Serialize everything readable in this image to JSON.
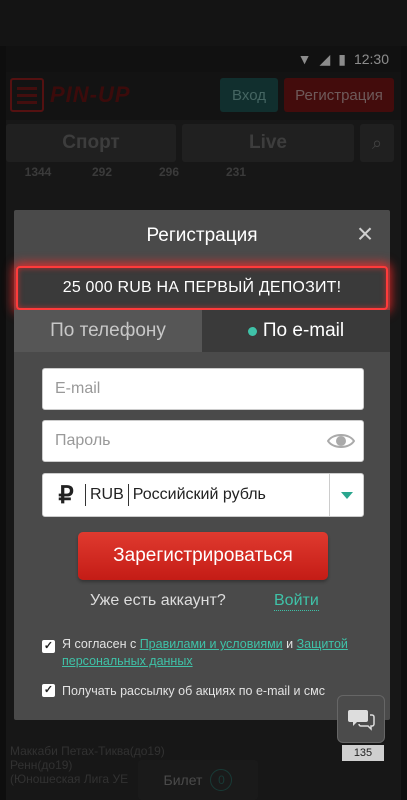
{
  "status_bar": {
    "time": "12:30"
  },
  "app": {
    "logo": "PIN-UP",
    "login_label": "Вход",
    "register_label": "Регистрация",
    "tabs": {
      "sport": "Спорт",
      "live": "Live"
    },
    "counts": [
      "1344",
      "292",
      "296",
      "231"
    ],
    "bg_event": {
      "line1": "Маккаби Петах-Тиква(до19)",
      "line2": "Ренн(до19)",
      "line3": "(Юношеская Лига УЕ"
    },
    "ticket": {
      "label": "Билет",
      "count": "0"
    },
    "badge": "135"
  },
  "modal": {
    "title": "Регистрация",
    "promo": "25 000 RUB НА ПЕРВЫЙ ДЕПОЗИТ!",
    "tab_phone": "По телефону",
    "tab_email": "По e-mail",
    "email_placeholder": "E-mail",
    "password_placeholder": "Пароль",
    "currency_symbol": "₽",
    "currency_code": "RUB",
    "currency_name": "Российский рубль",
    "submit": "Зарегистрироваться",
    "have_account": "Уже есть аккаунт?",
    "login_link": "Войти",
    "agree_prefix": "Я согласен с ",
    "agree_rules": "Правилами и условиями",
    "agree_and": " и ",
    "agree_privacy": "Защитой персональных данных",
    "newsletter": "Получать рассылку об акциях по e-mail и смс"
  },
  "colors": {
    "accent": "#3fc2a8",
    "danger": "#e03a2f"
  }
}
